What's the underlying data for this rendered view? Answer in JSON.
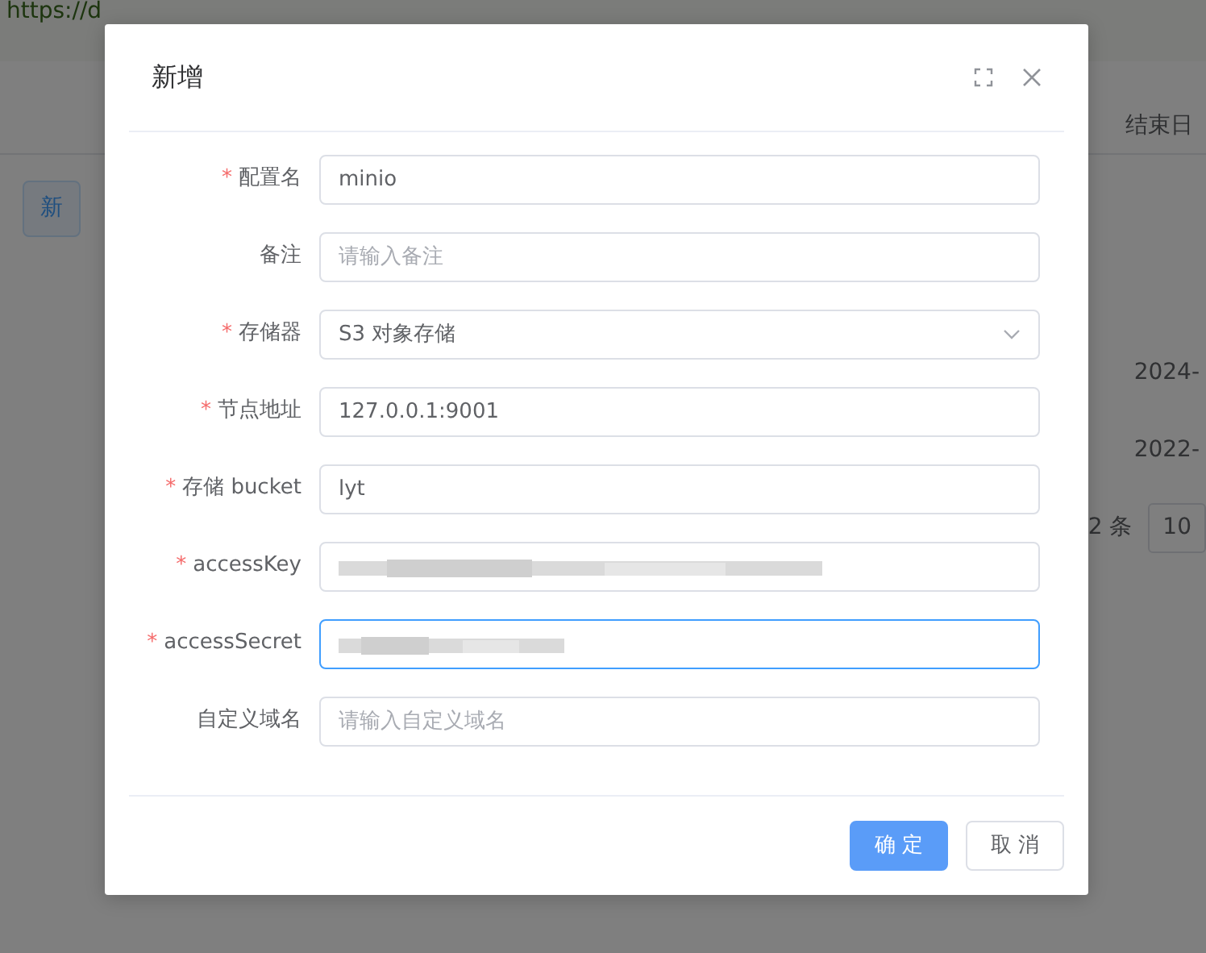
{
  "background": {
    "url": "https://d",
    "add_button": "新",
    "column_header": "结束日",
    "rows": [
      {
        "date": "2024-"
      },
      {
        "date": "2022-"
      }
    ],
    "total": "2 条",
    "page_size": "10"
  },
  "dialog": {
    "title": "新增",
    "fields": [
      {
        "label": "配置名",
        "required_mark": "*",
        "kind": "input",
        "value": "minio",
        "focused": false
      },
      {
        "label": "备注",
        "kind": "input",
        "placeholder": "请输入备注",
        "focused": false
      },
      {
        "label": "存储器",
        "required_mark": "*",
        "kind": "select",
        "value": "S3 对象存储",
        "focused": false
      },
      {
        "label": "节点地址",
        "required_mark": "*",
        "kind": "input",
        "value": "127.0.0.1:9001",
        "focused": false
      },
      {
        "label": "存储 bucket",
        "required_mark": "*",
        "kind": "input",
        "value": "lyt",
        "focused": false
      },
      {
        "label": "accessKey",
        "required_mark": "*",
        "kind": "redacted",
        "focused": false
      },
      {
        "label": "accessSecret",
        "required_mark": "*",
        "kind": "redacted",
        "focused": true
      },
      {
        "label": "自定义域名",
        "kind": "input",
        "placeholder": "请输入自定义域名",
        "focused": false
      }
    ],
    "buttons": [
      {
        "label": "确 定",
        "primary": true
      },
      {
        "label": "取 消",
        "primary": false
      }
    ]
  }
}
